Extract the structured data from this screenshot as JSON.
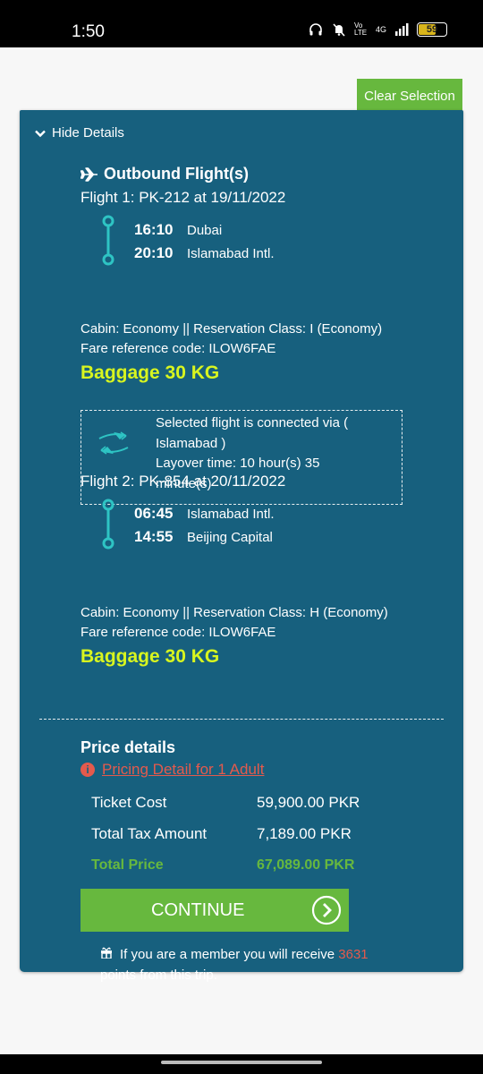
{
  "status_bar": {
    "time": "1:50",
    "network": "4G",
    "volte": "Vo LTE",
    "battery": "59"
  },
  "header": {
    "clear_selection_label": "Clear Selection"
  },
  "card": {
    "hide_details_label": "Hide Details",
    "outbound_title": "Outbound Flight(s)",
    "flights": [
      {
        "title": "Flight 1: PK-212 at 19/11/2022",
        "dep_time": "16:10",
        "dep_place": "Dubai",
        "arr_time": "20:10",
        "arr_place": "Islamabad Intl.",
        "cabin": "Cabin: Economy || Reservation Class: I (Economy)",
        "fare": "Fare reference code: ILOW6FAE",
        "baggage": "Baggage 30 KG"
      },
      {
        "title": "Flight 2: PK-854 at 20/11/2022",
        "dep_time": "06:45",
        "dep_place": "Islamabad Intl.",
        "arr_time": "14:55",
        "arr_place": "Beijing Capital",
        "cabin": "Cabin: Economy || Reservation Class: H (Economy)",
        "fare": "Fare reference code: ILOW6FAE",
        "baggage": "Baggage 30 KG"
      }
    ],
    "connection": {
      "via_line1": "Selected flight is connected via (",
      "via_line2": "Islamabad )",
      "layover_line1": "Layover time: 10 hour(s) 35",
      "layover_line2": "minute(s)"
    },
    "price": {
      "title": "Price details",
      "pricing_link": "Pricing Detail for 1 Adult",
      "ticket_cost_label": "Ticket Cost",
      "ticket_cost_value": "59,900.00 PKR",
      "tax_label": "Total Tax Amount",
      "tax_value": "7,189.00 PKR",
      "total_label": "Total Price",
      "total_value": "67,089.00 PKR"
    },
    "continue_label": "CONTINUE",
    "member_note": {
      "before": "If you are a member you will receive",
      "points": "3631",
      "after": "points from this trip."
    }
  },
  "colors": {
    "card_bg": "#17607e",
    "accent_green": "#67b83e",
    "baggage_yellow": "#d8f51f",
    "link_red": "#e45a4d",
    "route_teal": "#2ec4c4"
  }
}
